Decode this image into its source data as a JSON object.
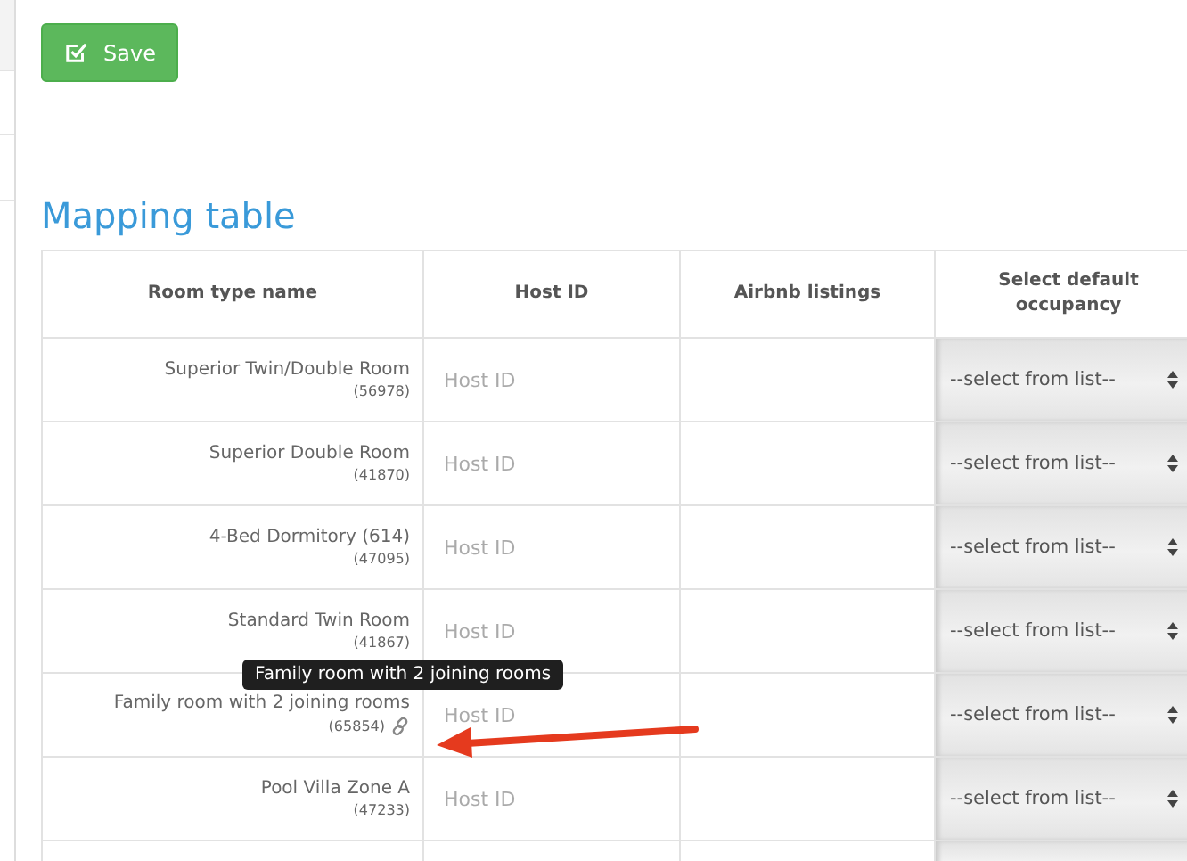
{
  "save_button": {
    "label": "Save"
  },
  "heading": "Mapping table",
  "table": {
    "columns": [
      "Room type name",
      "Host ID",
      "Airbnb listings",
      "Select default occupancy"
    ],
    "rows": [
      {
        "name": "Superior Twin/Double Room",
        "code": "(56978)",
        "host_id_placeholder": "Host ID",
        "occupancy": "--select from list--",
        "linked": false
      },
      {
        "name": "Superior Double Room",
        "code": "(41870)",
        "host_id_placeholder": "Host ID",
        "occupancy": "--select from list--",
        "linked": false
      },
      {
        "name": "4-Bed Dormitory (614)",
        "code": "(47095)",
        "host_id_placeholder": "Host ID",
        "occupancy": "--select from list--",
        "linked": false
      },
      {
        "name": "Standard Twin Room",
        "code": "(41867)",
        "host_id_placeholder": "Host ID",
        "occupancy": "--select from list--",
        "linked": false
      },
      {
        "name": "Family room with 2 joining rooms",
        "code": "(65854)",
        "host_id_placeholder": "Host ID",
        "occupancy": "--select from list--",
        "linked": true,
        "tooltip": "Family room with 2 joining rooms"
      },
      {
        "name": "Pool Villa Zone A",
        "code": "(47233)",
        "host_id_placeholder": "Host ID",
        "occupancy": "--select from list--",
        "linked": false
      }
    ]
  }
}
